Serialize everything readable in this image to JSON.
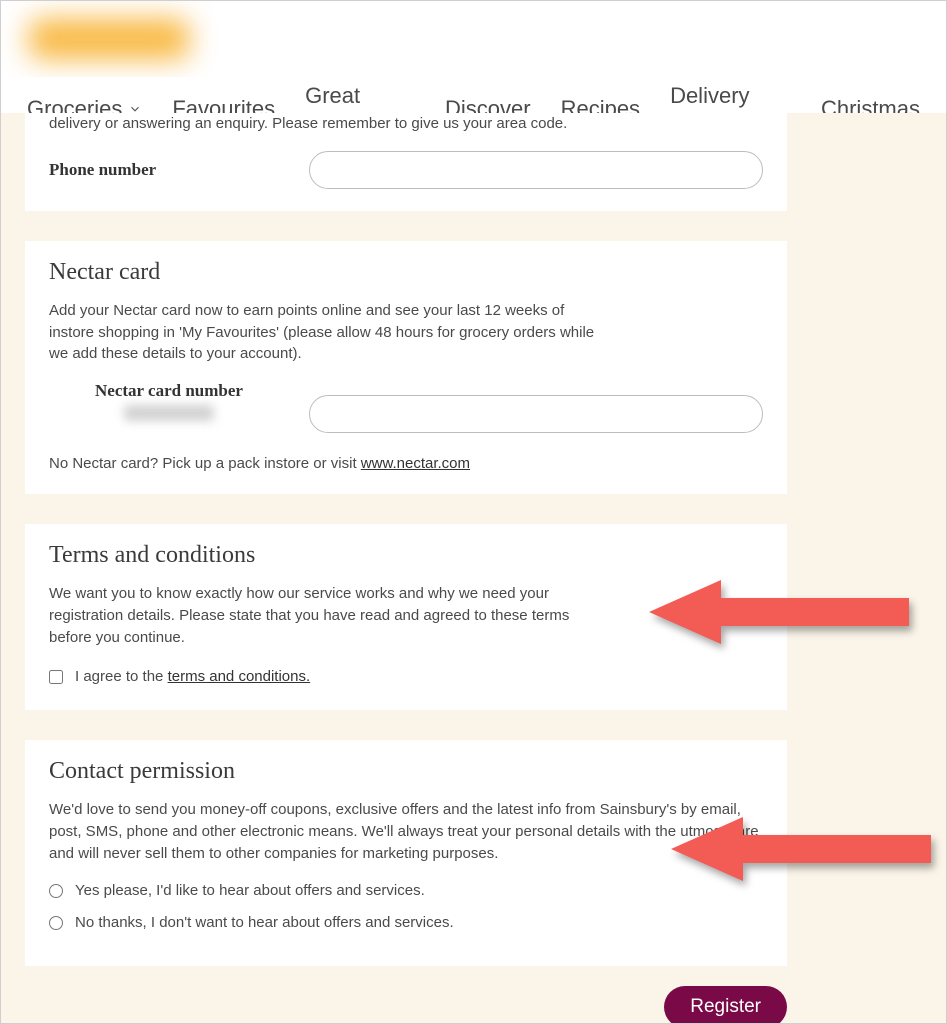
{
  "nav": {
    "items": [
      {
        "label": "Groceries",
        "has_dropdown": true
      },
      {
        "label": "Favourites",
        "has_dropdown": false
      },
      {
        "label": "Great Prices",
        "has_dropdown": false
      },
      {
        "label": "Discover",
        "has_dropdown": false
      },
      {
        "label": "Recipes",
        "has_dropdown": false
      },
      {
        "label": "Delivery Pass",
        "has_dropdown": false
      },
      {
        "label": "Christmas",
        "has_dropdown": false
      }
    ]
  },
  "phone_section": {
    "intro": "delivery or answering an enquiry. Please remember to give us your area code.",
    "label": "Phone number",
    "value": ""
  },
  "nectar": {
    "title": "Nectar card",
    "desc": "Add your Nectar card now to earn points online and see your last 12 weeks of instore shopping in 'My Favourites' (please allow 48 hours for grocery orders while we add these details to your account).",
    "label": "Nectar card number",
    "value": "",
    "no_card_prefix": "No Nectar card? Pick up a pack instore or visit ",
    "no_card_link": "www.nectar.com"
  },
  "terms": {
    "title": "Terms and conditions",
    "desc": "We want you to know exactly how our service works and why we need your registration details. Please state that you have read and agreed to these terms before you continue.",
    "checkbox_prefix": "I agree to the ",
    "checkbox_link": "terms and conditions."
  },
  "contact": {
    "title": "Contact permission",
    "desc": "We'd love to send you money-off coupons, exclusive offers and the latest info from Sainsbury's by email, post, SMS, phone and other electronic means. We'll always treat your personal details with the utmost care and will never sell them to other companies for marketing purposes.",
    "options": [
      "Yes please, I'd like to hear about offers and services.",
      "No thanks, I don't want to hear about offers and services."
    ]
  },
  "register_label": "Register"
}
